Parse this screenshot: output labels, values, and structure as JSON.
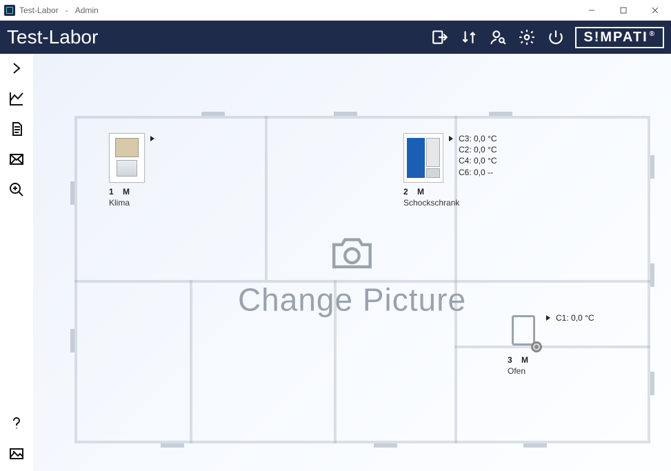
{
  "window": {
    "title_app": "Test-Labor",
    "title_sep": "-",
    "title_user": "Admin"
  },
  "header": {
    "title": "Test-Labor",
    "brand": "S!MPATI",
    "brand_reg": "®"
  },
  "placeholder": {
    "label": "Change Picture"
  },
  "devices": [
    {
      "id": "1",
      "mode": "M",
      "name": "Klima",
      "readings": []
    },
    {
      "id": "2",
      "mode": "M",
      "name": "Schockschrank",
      "readings": [
        {
          "label": "C3:",
          "value": "0,0",
          "unit": "°C"
        },
        {
          "label": "C2:",
          "value": "0,0",
          "unit": "°C"
        },
        {
          "label": "C4:",
          "value": "0,0",
          "unit": "°C"
        },
        {
          "label": "C6:",
          "value": "0,0",
          "unit": "--"
        }
      ]
    },
    {
      "id": "3",
      "mode": "M",
      "name": "Ofen",
      "readings": [
        {
          "label": "C1:",
          "value": "0,0",
          "unit": "°C"
        }
      ]
    }
  ]
}
